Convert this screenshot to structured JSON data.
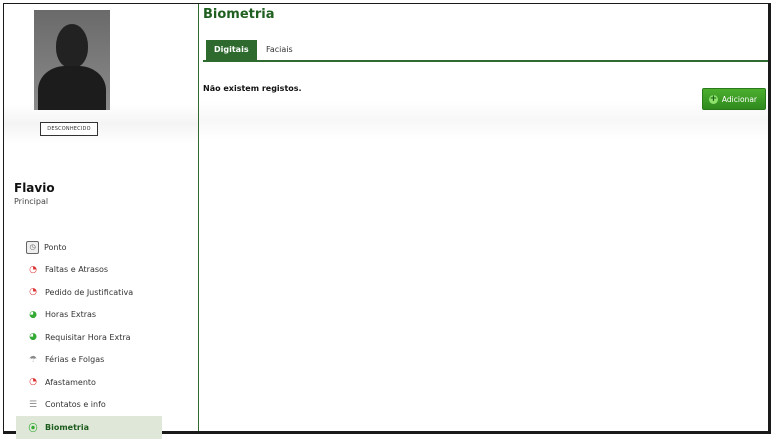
{
  "profile": {
    "status_label": "DESCONHECIDO",
    "name": "Flavio",
    "role": "Principal"
  },
  "menu": [
    {
      "label": "Ponto",
      "icon": "clock-icon"
    },
    {
      "label": "Faltas e Atrasos",
      "icon": "alert-clock-icon"
    },
    {
      "label": "Pedido de Justificativa",
      "icon": "alert-clock-icon"
    },
    {
      "label": "Horas Extras",
      "icon": "overtime-clock-icon"
    },
    {
      "label": "Requisitar Hora Extra",
      "icon": "overtime-clock-icon"
    },
    {
      "label": "Férias e Folgas",
      "icon": "umbrella-icon"
    },
    {
      "label": "Afastamento",
      "icon": "alert-clock-icon"
    },
    {
      "label": "Contatos e info",
      "icon": "list-icon"
    },
    {
      "label": "Biometria",
      "icon": "fingerprint-icon",
      "active": true
    }
  ],
  "page": {
    "title": "Biometria",
    "tabs": [
      {
        "label": "Digitais",
        "active": true
      },
      {
        "label": "Faciais",
        "active": false
      }
    ],
    "empty_message": "Não existem registos.",
    "add_button": "Adicionar"
  },
  "colors": {
    "accent": "#2e6a2e",
    "title": "#1f5f1f",
    "button": "#3a9a24"
  }
}
